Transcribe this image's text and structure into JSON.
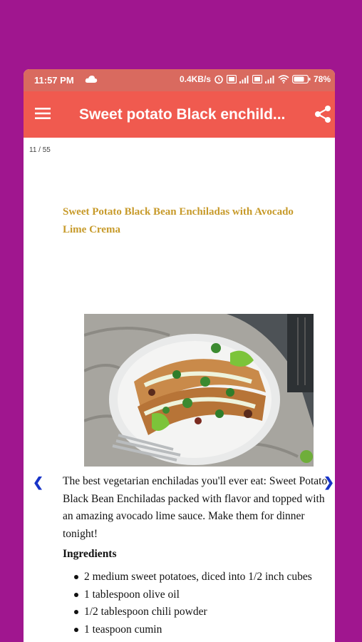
{
  "status_bar": {
    "time": "11:57 PM",
    "network_speed": "0.4KB/s",
    "battery": "78%",
    "icons": [
      "cloud-icon",
      "alarm-icon",
      "volte-icon",
      "signal-icon",
      "wifi-icon",
      "battery-icon"
    ]
  },
  "app_bar": {
    "title": "Sweet potato Black enchild...",
    "menu_icon": "hamburger-menu-icon",
    "share_icon": "share-icon",
    "background": "#f05a4f"
  },
  "content": {
    "page_counter": "11 / 55",
    "recipe_title": "Sweet Potato Black Bean Enchiladas with Avocado Lime Crema",
    "title_color": "#c79a2a",
    "description": "The best vegetarian enchiladas you'll ever eat: Sweet Potato Black Bean Enchiladas packed with flavor and topped with an amazing avocado lime sauce. Make them for dinner tonight!",
    "ingredients_heading": "Ingredients",
    "ingredients": [
      "2 medium sweet potatoes, diced into 1/2 inch cubes",
      "1 tablespoon olive oil",
      "1/2 tablespoon chili powder",
      "1 teaspoon cumin"
    ],
    "prev_arrow": "❮",
    "next_arrow": "❯",
    "arrow_color": "#1834c8"
  },
  "background_color": "#a0168f"
}
